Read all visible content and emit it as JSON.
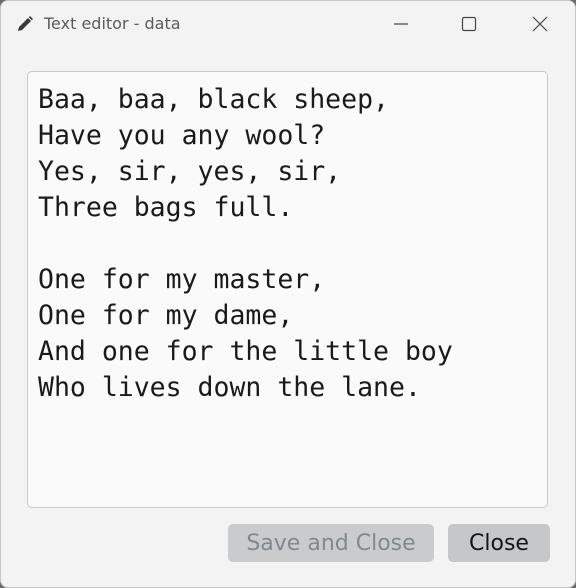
{
  "window": {
    "title": "Text editor - data",
    "controls": {
      "minimize_icon": "minimize-icon",
      "maximize_icon": "maximize-icon",
      "close_icon": "close-icon"
    }
  },
  "editor": {
    "content": "Baa, baa, black sheep,\nHave you any wool?\nYes, sir, yes, sir,\nThree bags full.\n\nOne for my master,\nOne for my dame,\nAnd one for the little boy\nWho lives down the lane."
  },
  "footer": {
    "save_label": "Save and Close",
    "close_label": "Close"
  },
  "colors": {
    "window_bg": "#f3f3f3",
    "editor_bg": "#fafafa",
    "disabled_button_bg": "#c9cbcd",
    "disabled_button_text": "#7f8a91",
    "button_bg": "#c6c7c8"
  }
}
